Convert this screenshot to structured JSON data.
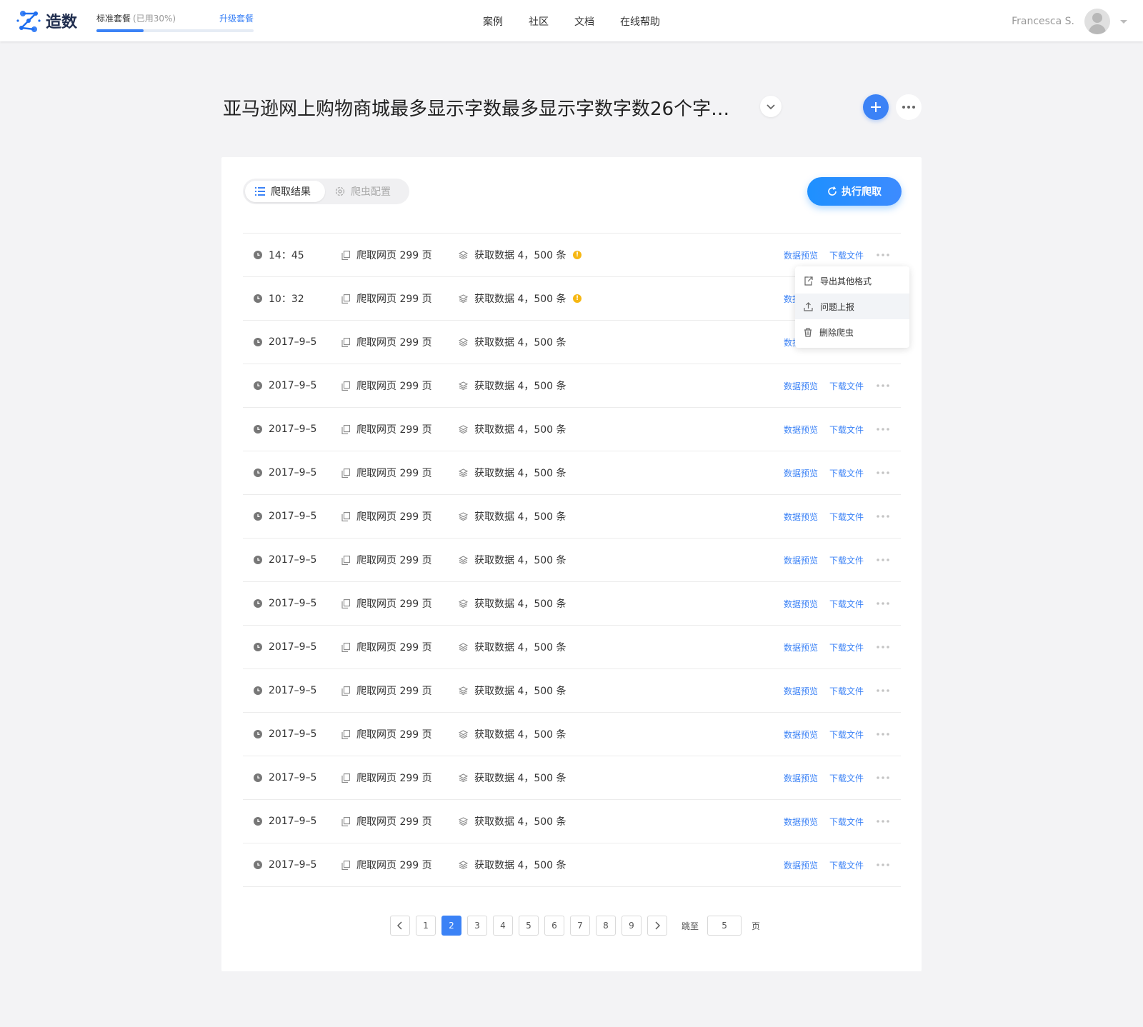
{
  "header": {
    "logo_text": "造数",
    "plan": {
      "name": "标准套餐",
      "usage": "(已用30%)",
      "usage_fraction": 0.3,
      "upgrade_label": "升级套餐"
    },
    "nav": [
      "案例",
      "社区",
      "文档",
      "在线帮助"
    ],
    "user_name": "Francesca S."
  },
  "project": {
    "title": "亚马逊网上购物商城最多显示字数最多显示字数字数26个字…"
  },
  "tabs": {
    "results": "爬取结果",
    "config": "爬虫配置"
  },
  "run_button": "执行爬取",
  "rows": [
    {
      "time": "14：45",
      "pages": "爬取网页 299 页",
      "data": "获取数据 4，500 条",
      "warning": true
    },
    {
      "time": "10：32",
      "pages": "爬取网页 299 页",
      "data": "获取数据 4，500 条",
      "warning": true
    },
    {
      "time": "2017–9–5",
      "pages": "爬取网页 299 页",
      "data": "获取数据 4，500 条",
      "warning": false
    },
    {
      "time": "2017–9–5",
      "pages": "爬取网页 299 页",
      "data": "获取数据 4，500 条",
      "warning": false
    },
    {
      "time": "2017–9–5",
      "pages": "爬取网页 299 页",
      "data": "获取数据 4，500 条",
      "warning": false
    },
    {
      "time": "2017–9–5",
      "pages": "爬取网页 299 页",
      "data": "获取数据 4，500 条",
      "warning": false
    },
    {
      "time": "2017–9–5",
      "pages": "爬取网页 299 页",
      "data": "获取数据 4，500 条",
      "warning": false
    },
    {
      "time": "2017–9–5",
      "pages": "爬取网页 299 页",
      "data": "获取数据 4，500 条",
      "warning": false
    },
    {
      "time": "2017–9–5",
      "pages": "爬取网页 299 页",
      "data": "获取数据 4，500 条",
      "warning": false
    },
    {
      "time": "2017–9–5",
      "pages": "爬取网页 299 页",
      "data": "获取数据 4，500 条",
      "warning": false
    },
    {
      "time": "2017–9–5",
      "pages": "爬取网页 299 页",
      "data": "获取数据 4，500 条",
      "warning": false
    },
    {
      "time": "2017–9–5",
      "pages": "爬取网页 299 页",
      "data": "获取数据 4，500 条",
      "warning": false
    },
    {
      "time": "2017–9–5",
      "pages": "爬取网页 299 页",
      "data": "获取数据 4，500 条",
      "warning": false
    },
    {
      "time": "2017–9–5",
      "pages": "爬取网页 299 页",
      "data": "获取数据 4，500 条",
      "warning": false
    },
    {
      "time": "2017–9–5",
      "pages": "爬取网页 299 页",
      "data": "获取数据 4，500 条",
      "warning": false
    }
  ],
  "row_actions": {
    "preview": "数据预览",
    "download": "下载文件"
  },
  "popup_menu": [
    {
      "label": "导出其他格式",
      "icon": "export-icon"
    },
    {
      "label": "问题上报",
      "icon": "upload-icon"
    },
    {
      "label": "删除爬虫",
      "icon": "trash-icon"
    }
  ],
  "pagination": {
    "pages": [
      "1",
      "2",
      "3",
      "4",
      "5",
      "6",
      "7",
      "8",
      "9"
    ],
    "current": "2",
    "jump_label": "跳至",
    "jump_value": "5",
    "page_suffix": "页"
  },
  "colors": {
    "accent": "#3b82f6",
    "warning": "#f6b713",
    "background": "#f3f3f5"
  }
}
